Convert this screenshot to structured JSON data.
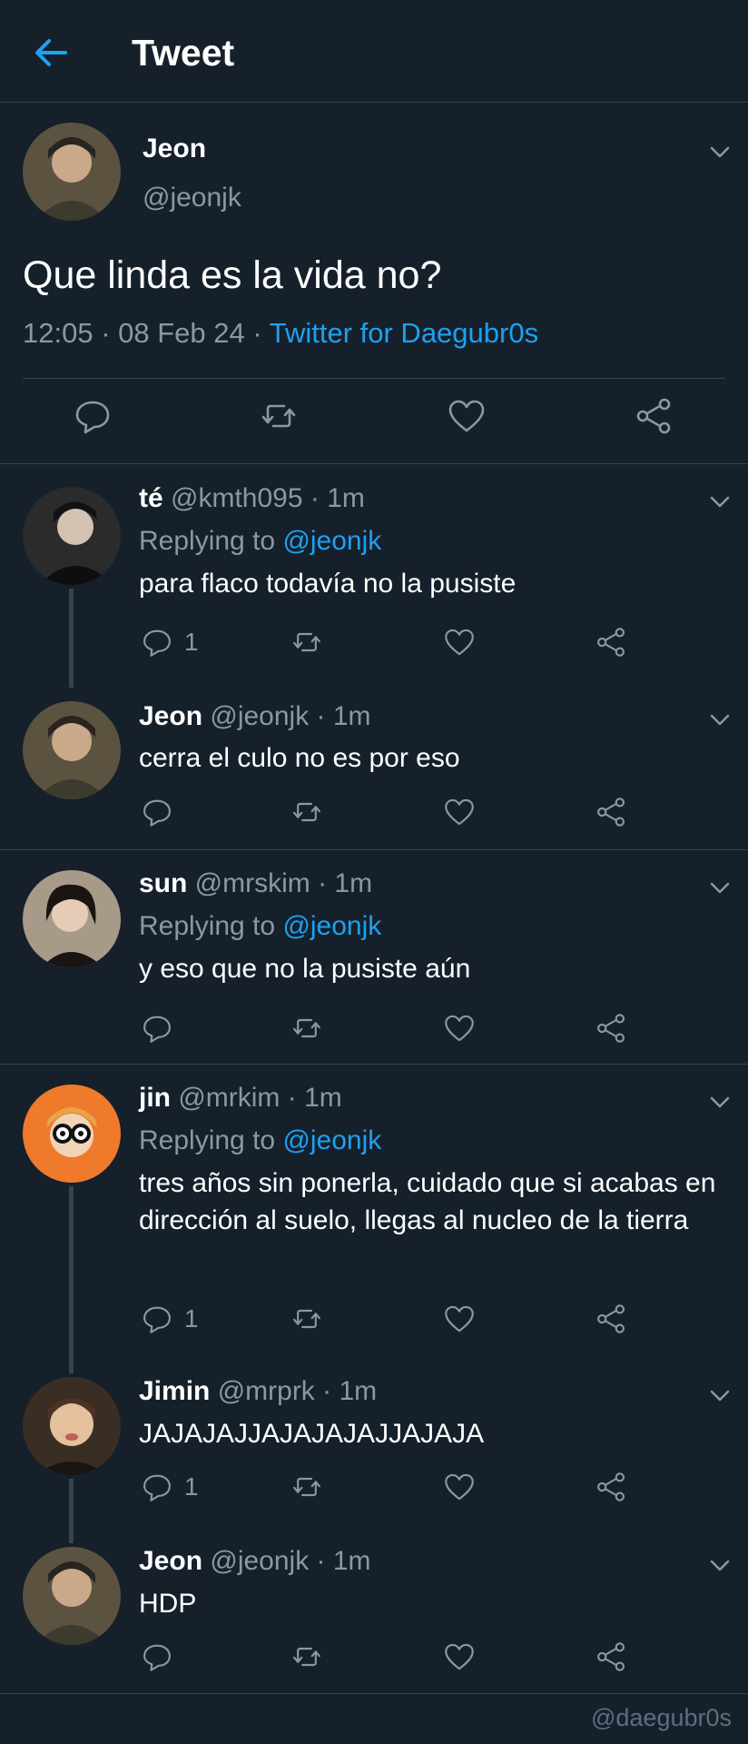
{
  "header": {
    "title": "Tweet",
    "back_icon": "arrow-left-icon",
    "accent": "#1da1f2"
  },
  "main_tweet": {
    "name": "Jeon",
    "handle": "@jeonjk",
    "text": "Que linda es la vida no?",
    "time": "12:05 · 08 Feb 24 · ",
    "source": "Twitter for Daegubr0s"
  },
  "replies": [
    {
      "name": "té",
      "meta": " @kmth095 · 1m",
      "replying_prefix": "Replying to ",
      "replying_to": "@jeonjk",
      "text": "para flaco todavía no la pusiste",
      "reply_count": "1"
    },
    {
      "name": "Jeon",
      "meta": " @jeonjk · 1m",
      "text": "cerra el culo no es por eso"
    },
    {
      "name": "sun",
      "meta": " @mrskim · 1m",
      "replying_prefix": "Replying to ",
      "replying_to": "@jeonjk",
      "text": "y eso que no la pusiste aún"
    },
    {
      "name": "jin",
      "meta": " @mrkim · 1m",
      "replying_prefix": "Replying to ",
      "replying_to": "@jeonjk",
      "text": "tres años sin ponerla, cuidado que si acabas en dirección al suelo, llegas al nucleo de la tierra",
      "reply_count": "1"
    },
    {
      "name": "Jimin",
      "meta": " @mrprk · 1m",
      "text": "JAJAJAJJAJAJAJAJJAJAJA",
      "reply_count": "1"
    },
    {
      "name": "Jeon",
      "meta": " @jeonjk · 1m",
      "text": "HDP"
    }
  ],
  "watermark": "@daegubr0s"
}
